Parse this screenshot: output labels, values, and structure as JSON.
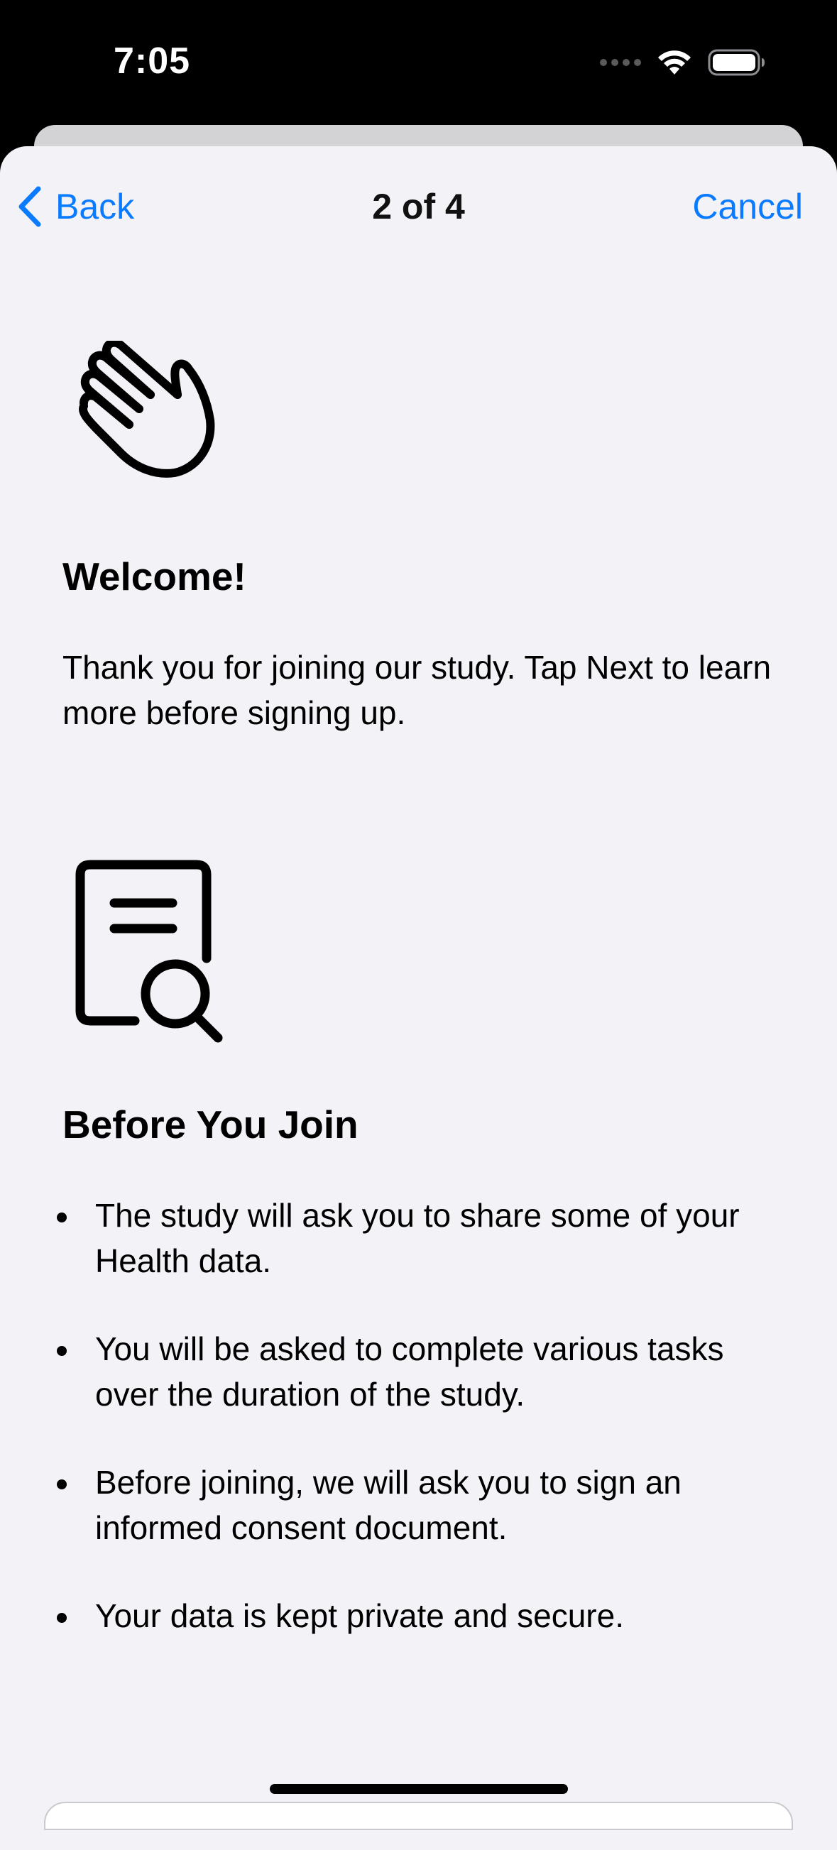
{
  "status_bar": {
    "time": "7:05",
    "icons": [
      "cellular-signal-icon",
      "wifi-icon",
      "battery-icon"
    ]
  },
  "nav": {
    "back_label": "Back",
    "title": "2 of 4",
    "cancel_label": "Cancel",
    "accent_color": "#0a7aff"
  },
  "welcome": {
    "icon": "hand-wave-icon",
    "title": "Welcome!",
    "body": "Thank you for joining our study. Tap Next to learn more before signing up."
  },
  "before_join": {
    "icon": "document-search-icon",
    "title": "Before You Join",
    "items": [
      "The study will ask you to share some of your Health data.",
      "You will be asked to complete various tasks over the duration of the study.",
      "Before joining, we will ask you to sign an informed consent document.",
      "Your data is kept private and secure."
    ]
  }
}
